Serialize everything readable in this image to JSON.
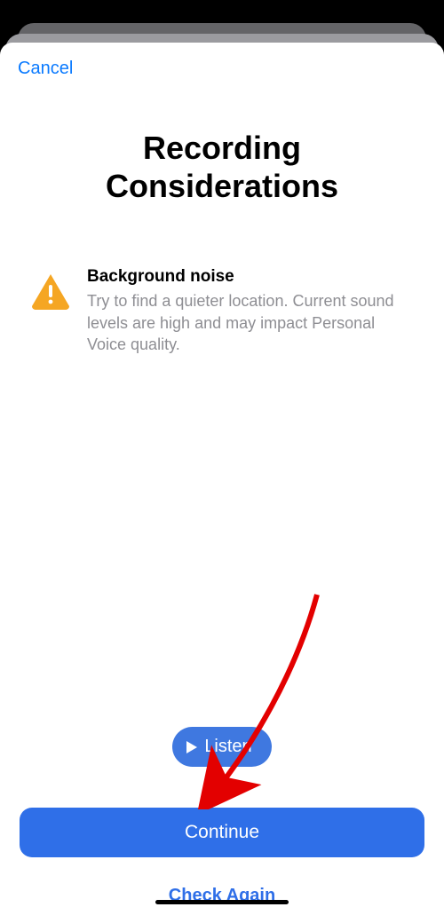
{
  "nav": {
    "cancel": "Cancel"
  },
  "title": "Recording\nConsiderations",
  "notice": {
    "heading": "Background noise",
    "body": "Try to find a quieter location. Current sound levels are high and may impact Personal Voice quality."
  },
  "buttons": {
    "listen": "Listen",
    "continue": "Continue",
    "check_again": "Check Again"
  },
  "colors": {
    "accent": "#2f6fe8",
    "warn": "#f5a623"
  }
}
